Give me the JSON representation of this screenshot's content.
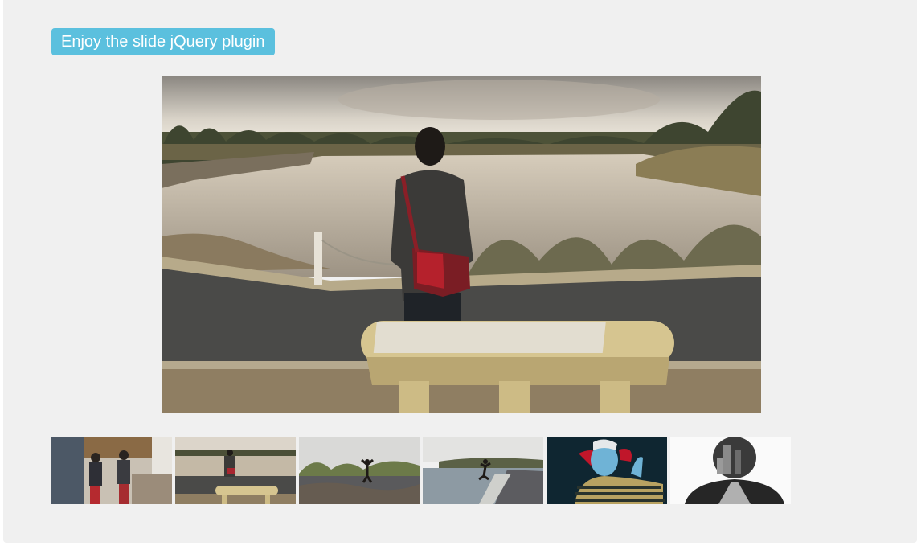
{
  "slider": {
    "title": "Enjoy the slide jQuery plugin",
    "main_image": {
      "alt": "man with red bag standing behind stone bench looking at a lake"
    },
    "thumbnails": [
      {
        "alt": "two people cooking in a kitchen"
      },
      {
        "alt": "man standing by lake behind bench"
      },
      {
        "alt": "person jumping on a path with fallen leaves"
      },
      {
        "alt": "person jumping on a path beside water"
      },
      {
        "alt": "inverted colors portrait of a person with hand at head"
      },
      {
        "alt": "double exposure silhouette with city skyline"
      }
    ],
    "colors": {
      "panel": "#f0f0f0",
      "badge": "#5bc0de",
      "badge_text": "#ffffff"
    }
  }
}
